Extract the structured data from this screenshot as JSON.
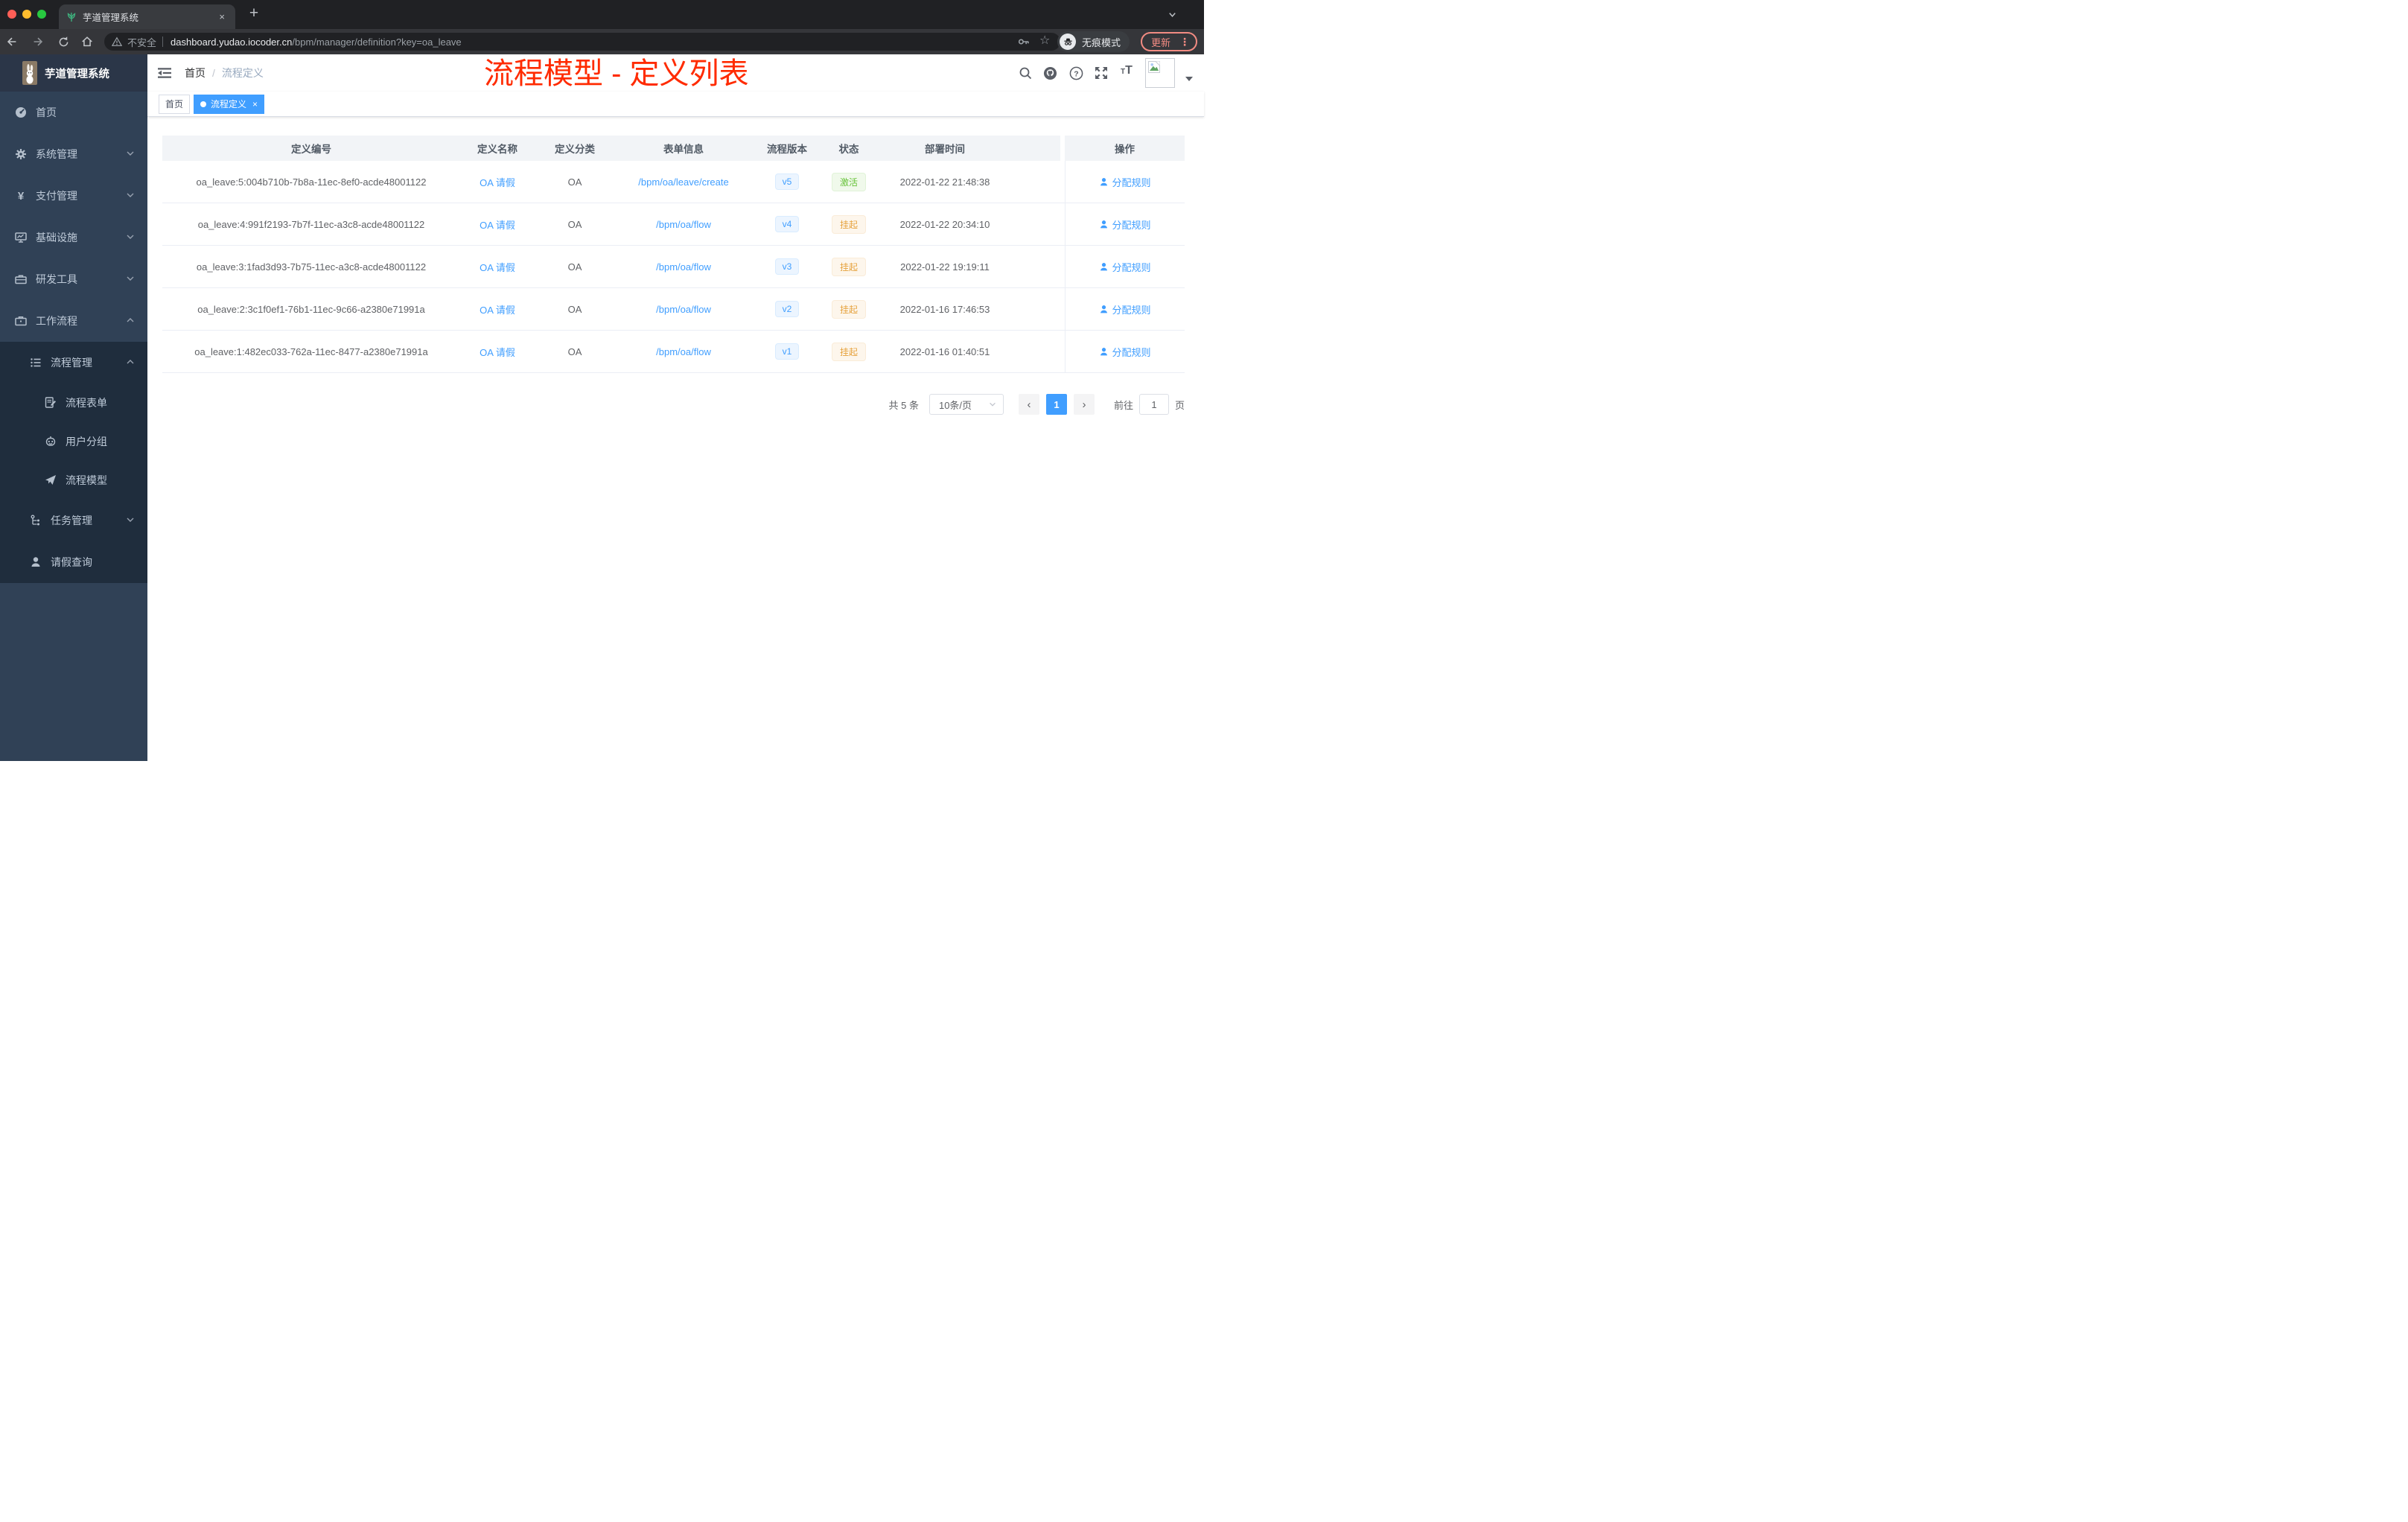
{
  "browser": {
    "tab_title": "芋道管理系统",
    "close_tab": "×",
    "new_tab": "+",
    "security": "不安全",
    "url_host": "dashboard.yudao.iocoder.cn",
    "url_path": "/bpm/manager/definition?key=oa_leave",
    "incognito": "无痕模式",
    "update": "更新",
    "update_color": "#f28b82"
  },
  "header": {
    "logo": "芋道管理系统",
    "breadcrumb": [
      "首页",
      "流程定义"
    ],
    "annotation": "流程模型 - 定义列表",
    "annotation_color": "#ff2b00",
    "primary_color": "#409eff"
  },
  "sidebar": {
    "items": [
      {
        "label": "首页",
        "level": 1,
        "expandable": false
      },
      {
        "label": "系统管理",
        "level": 1,
        "expandable": true,
        "expanded": false
      },
      {
        "label": "支付管理",
        "level": 1,
        "expandable": true,
        "expanded": false
      },
      {
        "label": "基础设施",
        "level": 1,
        "expandable": true,
        "expanded": false
      },
      {
        "label": "研发工具",
        "level": 1,
        "expandable": true,
        "expanded": false
      },
      {
        "label": "工作流程",
        "level": 1,
        "expandable": true,
        "expanded": true
      },
      {
        "label": "流程管理",
        "level": 2,
        "expandable": true,
        "expanded": true
      },
      {
        "label": "流程表单",
        "level": 3,
        "expandable": false
      },
      {
        "label": "用户分组",
        "level": 3,
        "expandable": false
      },
      {
        "label": "流程模型",
        "level": 3,
        "expandable": false
      },
      {
        "label": "任务管理",
        "level": 2,
        "expandable": true,
        "expanded": false
      },
      {
        "label": "请假查询",
        "level": 2,
        "expandable": false
      }
    ]
  },
  "tags": [
    {
      "label": "首页",
      "active": false
    },
    {
      "label": "流程定义",
      "active": true
    }
  ],
  "table": {
    "columns": [
      "定义编号",
      "定义名称",
      "定义分类",
      "表单信息",
      "流程版本",
      "状态",
      "部署时间",
      "操作"
    ],
    "rows": [
      {
        "id": "oa_leave:5:004b710b-7b8a-11ec-8ef0-acde48001122",
        "name": "OA 请假",
        "category": "OA",
        "form": "/bpm/oa/leave/create",
        "version": "v5",
        "status": "激活",
        "status_type": "success",
        "time": "2022-01-22 21:48:38",
        "action": "分配规则"
      },
      {
        "id": "oa_leave:4:991f2193-7b7f-11ec-a3c8-acde48001122",
        "name": "OA 请假",
        "category": "OA",
        "form": "/bpm/oa/flow",
        "version": "v4",
        "status": "挂起",
        "status_type": "warning",
        "time": "2022-01-22 20:34:10",
        "action": "分配规则"
      },
      {
        "id": "oa_leave:3:1fad3d93-7b75-11ec-a3c8-acde48001122",
        "name": "OA 请假",
        "category": "OA",
        "form": "/bpm/oa/flow",
        "version": "v3",
        "status": "挂起",
        "status_type": "warning",
        "time": "2022-01-22 19:19:11",
        "action": "分配规则"
      },
      {
        "id": "oa_leave:2:3c1f0ef1-76b1-11ec-9c66-a2380e71991a",
        "name": "OA 请假",
        "category": "OA",
        "form": "/bpm/oa/flow",
        "version": "v2",
        "status": "挂起",
        "status_type": "warning",
        "time": "2022-01-16 17:46:53",
        "action": "分配规则"
      },
      {
        "id": "oa_leave:1:482ec033-762a-11ec-8477-a2380e71991a",
        "name": "OA 请假",
        "category": "OA",
        "form": "/bpm/oa/flow",
        "version": "v1",
        "status": "挂起",
        "status_type": "warning",
        "time": "2022-01-16 01:40:51",
        "action": "分配规则"
      }
    ],
    "status_colors": {
      "success": "#67c23a",
      "warning": "#e6a23c"
    }
  },
  "pagination": {
    "total": "共 5 条",
    "page_size": "10条/页",
    "prev": "‹",
    "page": "1",
    "next": "›",
    "goto": "前往",
    "goto_value": "1",
    "unit": "页"
  }
}
